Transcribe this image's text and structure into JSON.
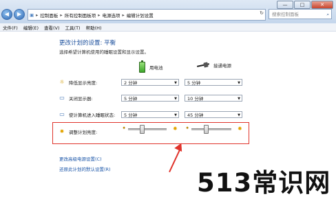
{
  "window": {
    "minimize": "—",
    "maximize": "□",
    "close": "✕"
  },
  "nav": {
    "back": "◀",
    "forward": "▶"
  },
  "address": {
    "crumbs": [
      "控制面板",
      "所有控制面板项",
      "电源选项",
      "编辑计划设置"
    ],
    "separator": "▸",
    "refresh": "↻"
  },
  "search": {
    "placeholder": "搜索控制面板"
  },
  "menubar": {
    "items": [
      "文件(F)",
      "编辑(E)",
      "查看(V)",
      "工具(T)",
      "帮助(H)"
    ]
  },
  "page": {
    "title": "更改计划的设置: 平衡",
    "subtitle": "选择希望计算机使用的睡眠设置和显示设置。"
  },
  "columns": {
    "battery": "用电池",
    "plugged": "接通电源"
  },
  "rows": [
    {
      "label": "降低显示亮度:",
      "battery": "2 分钟",
      "plugged": "5 分钟"
    },
    {
      "label": "关闭显示器:",
      "battery": "5 分钟",
      "plugged": "10 分钟"
    },
    {
      "label": "使计算机进入睡眠状态:",
      "battery": "5 分钟",
      "plugged": "45 分钟"
    }
  ],
  "brightness": {
    "label": "调整计划亮度:",
    "battery_level": 0.35,
    "plugged_level": 0.35
  },
  "links": {
    "advanced": "更改高级电源设置(C)",
    "restore": "还原此计划的默认设置(R)"
  },
  "watermark": "513常识网",
  "colors": {
    "highlight": "#e0332b",
    "link": "#1a55a8",
    "title": "#1b4f9c"
  }
}
